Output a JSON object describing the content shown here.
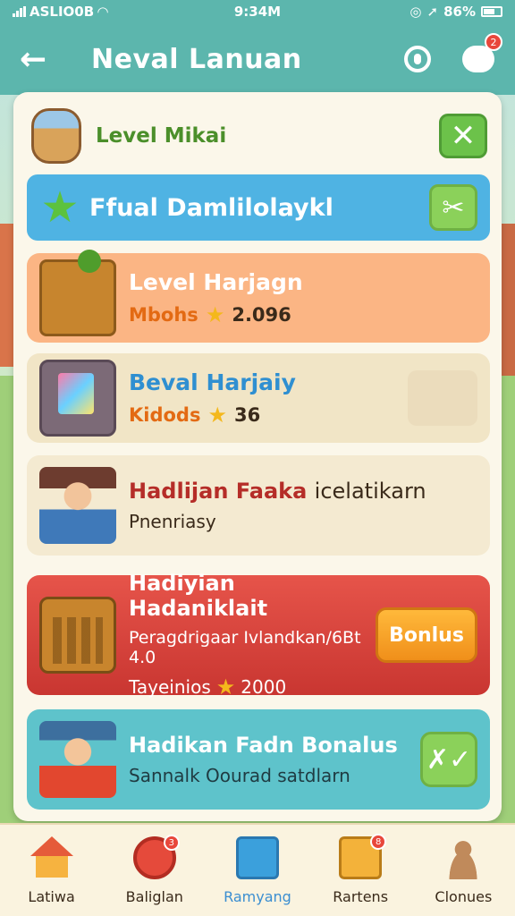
{
  "status": {
    "carrier": "ASLIO0B",
    "time": "9:34M",
    "battery": "86%"
  },
  "header": {
    "title": "Neval Lanuan",
    "chat_badge": "2"
  },
  "panel": {
    "row1_label": "Level Mikai",
    "row2_label": "Ffual Damlilolaykl",
    "cards": [
      {
        "title": "Level Harjagn",
        "sub_a": "Mbohs",
        "sub_b": "2.096"
      },
      {
        "title": "Beval Harjaiy",
        "sub_a": "Kidods",
        "sub_b": "36"
      },
      {
        "title_a": "Hadlijan Faaka",
        "title_b": "icelatikarn",
        "sub": "Pnenriasy"
      },
      {
        "title": "Hadiyian Hadaniklait",
        "line2": "Peragdrigaar Ivlandkan/6Bt 4.0",
        "line3_a": "Tayeinios",
        "line3_b": "2000",
        "button": "Bonlus"
      },
      {
        "title": "Hadikan Fadn Bonalus",
        "sub": "Sannalk Oourad satdlarn"
      }
    ]
  },
  "nav": {
    "items": [
      {
        "label": "Latiwa",
        "badge": ""
      },
      {
        "label": "Baliglan",
        "badge": "3"
      },
      {
        "label": "Ramyang",
        "badge": ""
      },
      {
        "label": "Rartens",
        "badge": "8"
      },
      {
        "label": "Clonues",
        "badge": ""
      }
    ],
    "active_index": 2
  },
  "colors": {
    "header": "#5cb6ad",
    "accent_red": "#e6544a",
    "accent_blue": "#4fb3e3",
    "accent_orange": "#fbb584",
    "accent_teal": "#5ec3cb"
  }
}
